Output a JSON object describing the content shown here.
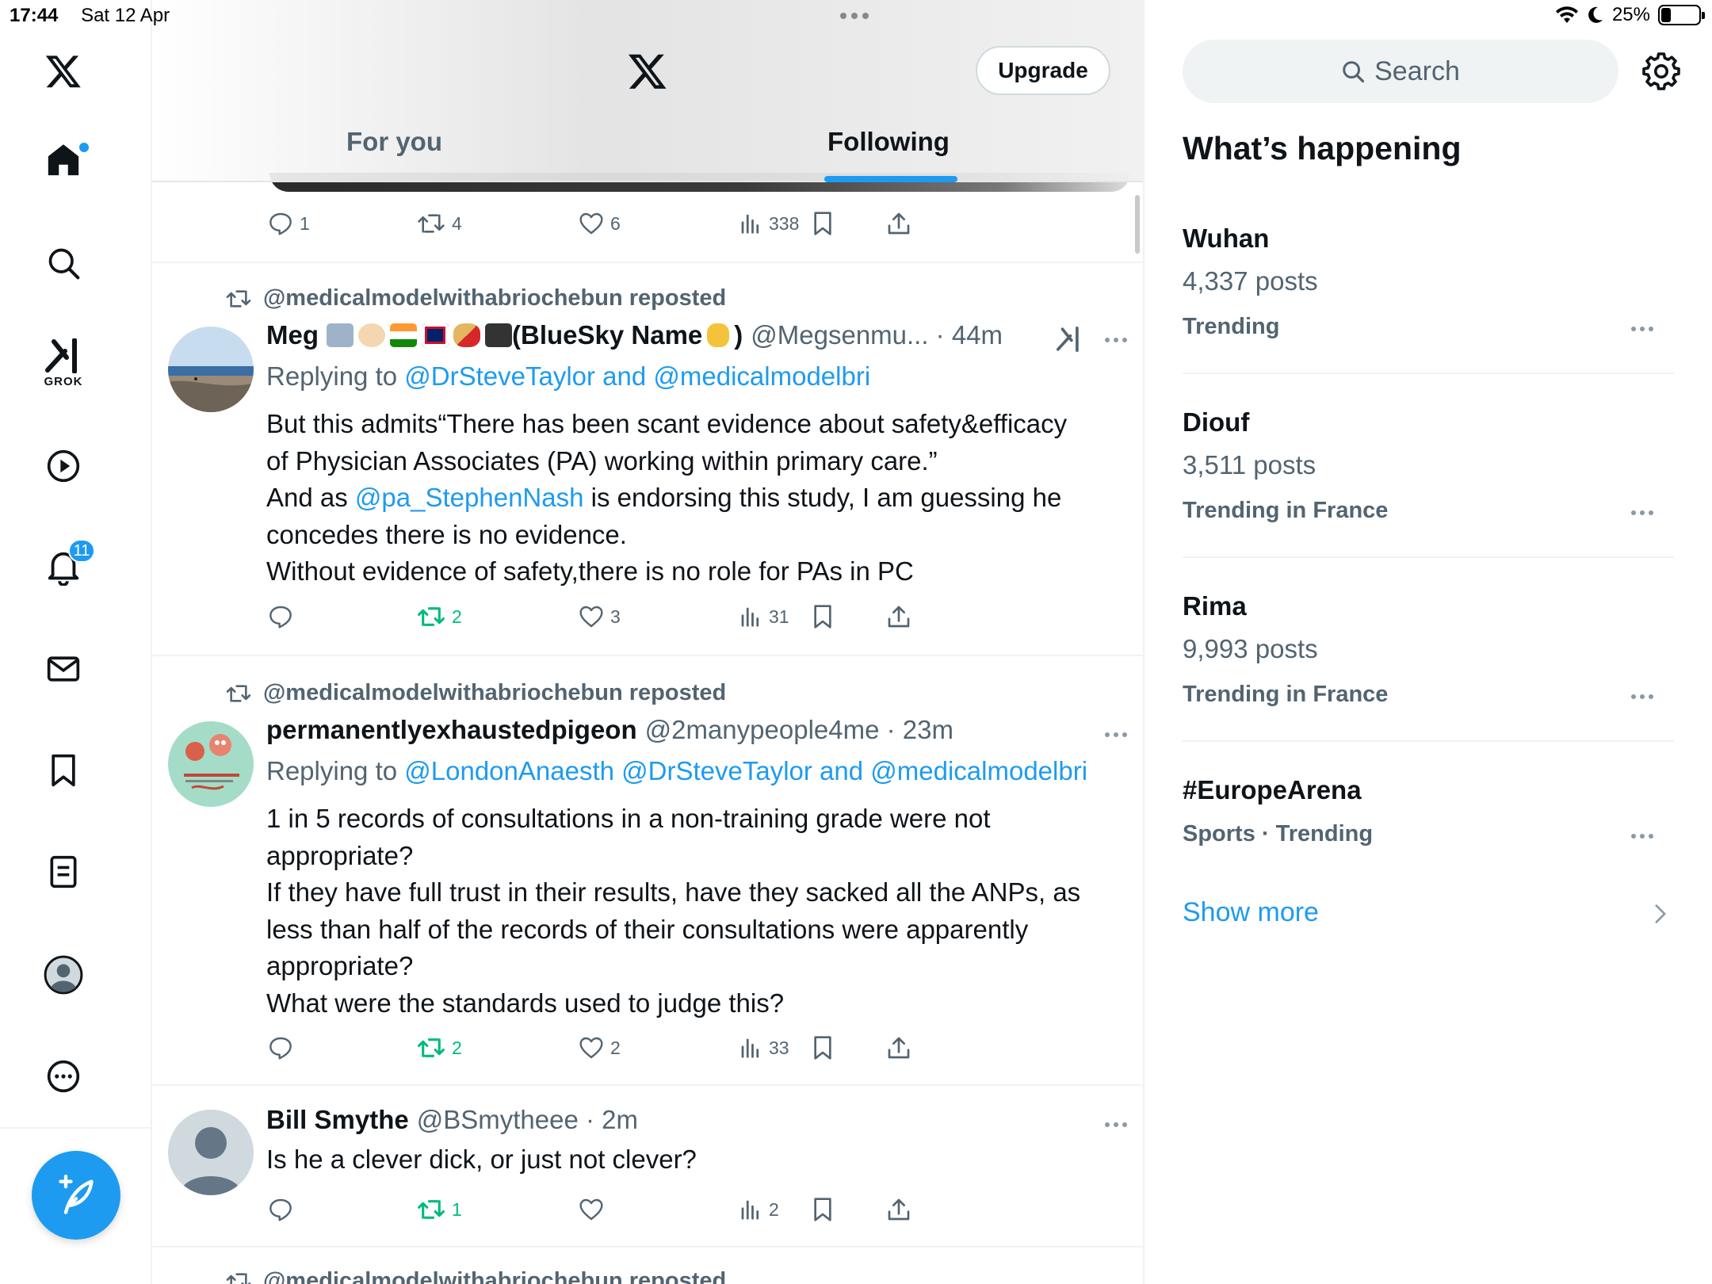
{
  "status_bar": {
    "time": "17:44",
    "date": "Sat 12 Apr",
    "battery": "25%",
    "battery_level_fraction": 0.25
  },
  "left_nav": {
    "items": [
      "home-icon",
      "search-icon",
      "grok-icon",
      "video-icon",
      "notifications-icon",
      "messages-icon",
      "bookmarks-icon",
      "lists-icon",
      "profile-icon",
      "more-icon"
    ],
    "grok_label": "GROK",
    "notification_count": "11"
  },
  "header": {
    "upgrade_label": "Upgrade",
    "tabs": [
      {
        "label": "For you",
        "active": false
      },
      {
        "label": "Following",
        "active": true
      }
    ]
  },
  "feed": {
    "top_partial_actions": {
      "replies": "1",
      "reposts": "4",
      "likes": "6",
      "views": "338"
    },
    "tweets": [
      {
        "reposted_by": "@medicalmodelwithabriochebun reposted",
        "name": "Meg",
        "name_suffix": "(BlueSky Name",
        "name_close": ")",
        "handle_time": "@Megsenmu... · 44m",
        "replying_prefix": "Replying to ",
        "replying_to": "@DrSteveTaylor and @medicalmodelbri",
        "body_1": "But this admits“There has been scant evidence about safety&efficacy",
        "body_2": "of Physician Associates (PA) working within primary care.”",
        "body_3a": "And as ",
        "body_3_mention": "@pa_StephenNash",
        "body_3b": " is endorsing this study, I am guessing he",
        "body_4": "concedes there is no evidence.",
        "body_5": "Without evidence of safety,there is no role for PAs in PC",
        "actions": {
          "replies": "",
          "reposts": "2",
          "likes": "3",
          "views": "31"
        }
      },
      {
        "reposted_by": "@medicalmodelwithabriochebun reposted",
        "name": "permanentlyexhaustedpigeon",
        "handle_time": "@2manypeople4me · 23m",
        "replying_prefix": "Replying to ",
        "replying_to": "@LondonAnaesth @DrSteveTaylor and @medicalmodelbri",
        "body_1": "1 in 5 records of consultations in a non-training grade were not",
        "body_2": "appropriate?",
        "body_3": "If they have full trust in their results, have they sacked all the ANPs, as",
        "body_4": "less than half of the records of their consultations were apparently",
        "body_5": "appropriate?",
        "body_6": "What were the standards used to judge this?",
        "actions": {
          "replies": "",
          "reposts": "2",
          "likes": "2",
          "views": "33"
        }
      },
      {
        "name": "Bill Smythe",
        "handle_time": "@BSmytheee · 2m",
        "body_1": "Is he a clever dick, or just not clever?",
        "actions": {
          "replies": "",
          "reposts": "1",
          "likes": "",
          "views": "2"
        }
      }
    ],
    "next_repost_line": "@medicalmodelwithabriochebun reposted"
  },
  "right": {
    "search_placeholder": "Search",
    "title": "What’s happening",
    "trends": [
      {
        "name": "Wuhan",
        "count": "4,337 posts",
        "context": "Trending"
      },
      {
        "name": "Diouf",
        "count": "3,511 posts",
        "context": "Trending in France"
      },
      {
        "name": "Rima",
        "count": "9,993 posts",
        "context": "Trending in France"
      },
      {
        "name": "#EuropeArena",
        "count": "",
        "context": "Sports · Trending"
      }
    ],
    "show_more": "Show more"
  },
  "colors": {
    "accent": "#1d9bf0",
    "repost_green": "#00ba7c",
    "secondary_text": "#536471"
  }
}
